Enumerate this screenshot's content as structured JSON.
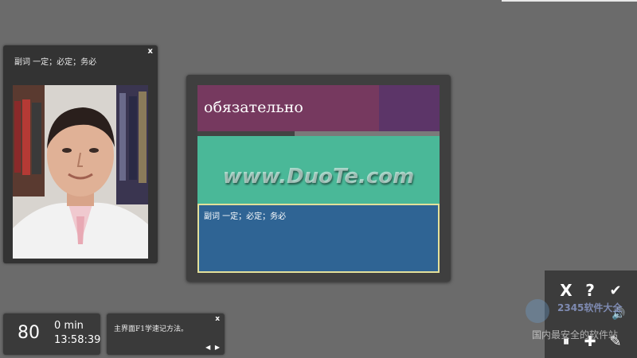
{
  "photo_panel": {
    "caption": "副词 一定；必定；务必",
    "close_label": "x"
  },
  "card": {
    "word": "обязательно",
    "progress_fraction": 0.4,
    "watermark": "www.DuoTe.com",
    "answer": "副词 一定；必定；务必"
  },
  "stats": {
    "count": "80",
    "minutes": "0 min",
    "clock": "13:58:39"
  },
  "hint": {
    "text": "主界面F1学速记方法。",
    "close_label": "x",
    "prev_label": "◀",
    "next_label": "▶"
  },
  "controls": {
    "close_glyph": "X",
    "help_glyph": "?",
    "check_glyph": "✔",
    "pause_glyph": "⏸",
    "add_glyph": "✚",
    "settings_glyph": "✎",
    "speaker_glyph": "🔊"
  },
  "site_watermark": {
    "brand": "2345软件大全",
    "tagline": "国内最安全的软件站"
  },
  "colors": {
    "background": "#6b6b6b",
    "word_row": "#76395f",
    "word_accent": "#5c3568",
    "teal": "#4ab898",
    "answer_bg": "#2f6494",
    "answer_border": "#e3e09a"
  }
}
